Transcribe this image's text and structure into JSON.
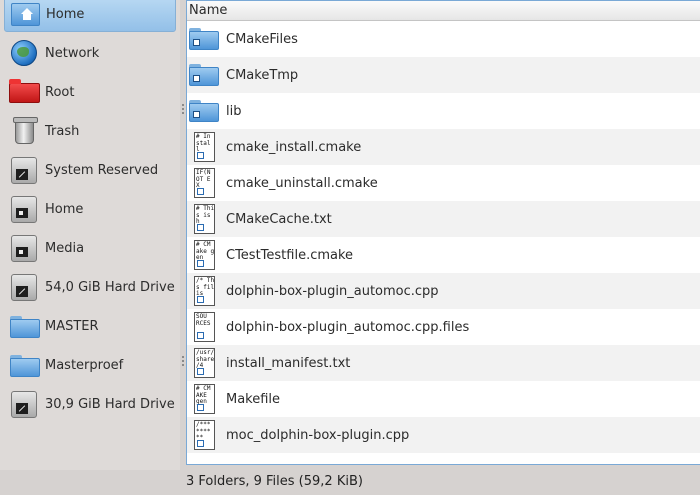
{
  "places": [
    {
      "label": "Home",
      "icon": "home-icon",
      "active": true
    },
    {
      "label": "Network",
      "icon": "network-icon"
    },
    {
      "label": "Root",
      "icon": "root-folder-icon"
    },
    {
      "label": "Trash",
      "icon": "trash-icon"
    },
    {
      "label": "System Reserved",
      "icon": "drive-icon"
    },
    {
      "label": "Home",
      "icon": "drive-icon"
    },
    {
      "label": "Media",
      "icon": "drive-icon"
    },
    {
      "label": "54,0 GiB Hard Drive",
      "icon": "drive-icon"
    },
    {
      "label": "MASTER",
      "icon": "folder-icon"
    },
    {
      "label": "Masterproef",
      "icon": "folder-icon"
    },
    {
      "label": "30,9 GiB Hard Drive",
      "icon": "drive-icon"
    }
  ],
  "file_view": {
    "column_name": "Name",
    "items": [
      {
        "name": "CMakeFiles",
        "type": "folder"
      },
      {
        "name": "CMakeTmp",
        "type": "folder"
      },
      {
        "name": "lib",
        "type": "folder"
      },
      {
        "name": "cmake_install.cmake",
        "type": "file",
        "preview": "# In\nstal\nl"
      },
      {
        "name": "cmake_uninstall.cmake",
        "type": "file",
        "preview": "IF(N\nOT E\nX"
      },
      {
        "name": "CMakeCache.txt",
        "type": "file",
        "preview": "# Thi\ns is t\nh"
      },
      {
        "name": "CTestTestfile.cmake",
        "type": "file",
        "preview": "# CM\nake g\nen"
      },
      {
        "name": "dolphin-box-plugin_automoc.cpp",
        "type": "file",
        "preview": "/* Thi\ns file\nis"
      },
      {
        "name": "dolphin-box-plugin_automoc.cpp.files",
        "type": "file",
        "preview": "SOU\nRCES\n"
      },
      {
        "name": "install_manifest.txt",
        "type": "file",
        "preview": "/usr/\nshare\n/4"
      },
      {
        "name": "Makefile",
        "type": "file",
        "preview": "# CM\nAKE\ngen"
      },
      {
        "name": "moc_dolphin-box-plugin.cpp",
        "type": "file",
        "preview": "/***\n****\n**"
      }
    ]
  },
  "status": {
    "text": "3 Folders, 9 Files (59,2 KiB)"
  }
}
